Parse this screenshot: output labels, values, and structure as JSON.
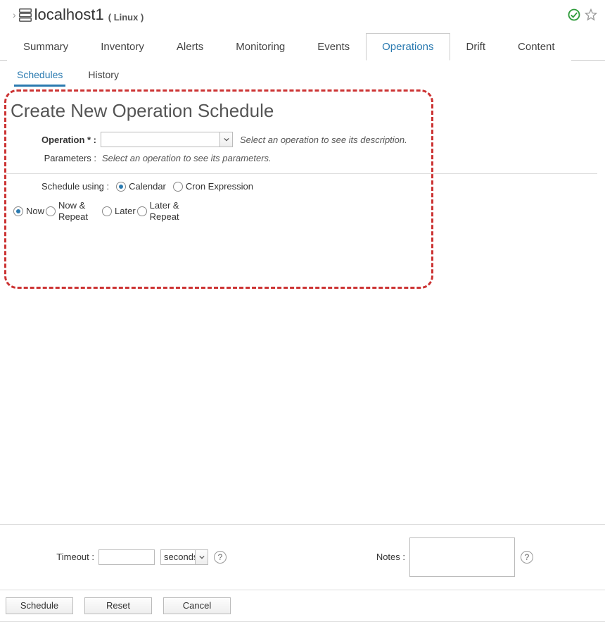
{
  "header": {
    "chevron": "›",
    "title": "localhost1",
    "subtitle": "( Linux )"
  },
  "tabs_primary": [
    "Summary",
    "Inventory",
    "Alerts",
    "Monitoring",
    "Events",
    "Operations",
    "Drift",
    "Content"
  ],
  "tabs_primary_active": "Operations",
  "tabs_secondary": [
    "Schedules",
    "History"
  ],
  "tabs_secondary_active": "Schedules",
  "section_title": "Create New Operation Schedule",
  "form": {
    "operation_label": "Operation * :",
    "operation_hint": "Select an operation to see its description.",
    "parameters_label": "Parameters :",
    "parameters_hint": "Select an operation to see its parameters.",
    "schedule_using_label": "Schedule using :",
    "schedule_using_options": [
      "Calendar",
      "Cron Expression"
    ],
    "schedule_using_selected": "Calendar",
    "when_options": [
      "Now",
      "Now & Repeat",
      "Later",
      "Later & Repeat"
    ],
    "when_selected": "Now"
  },
  "footer": {
    "timeout_label": "Timeout :",
    "timeout_unit": "seconds",
    "notes_label": "Notes :"
  },
  "buttons": {
    "schedule": "Schedule",
    "reset": "Reset",
    "cancel": "Cancel"
  }
}
